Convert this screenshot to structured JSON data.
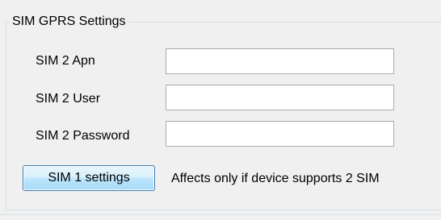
{
  "group": {
    "title": "SIM GPRS Settings"
  },
  "fields": [
    {
      "label": "SIM 2 Apn",
      "value": ""
    },
    {
      "label": "SIM 2 User",
      "value": ""
    },
    {
      "label": "SIM 2 Password",
      "value": ""
    }
  ],
  "button": {
    "label": "SIM 1 settings"
  },
  "note": "Affects only if device supports 2 SIM"
}
